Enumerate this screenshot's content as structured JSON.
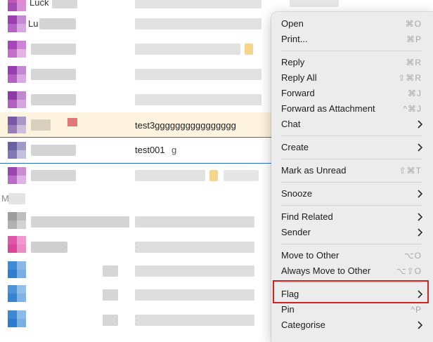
{
  "mail_list": {
    "top_partial_name": "Luck",
    "row2_partial_name": "Lu",
    "highlight_subject": "test3gggggggggggggggg",
    "selected_subject": "test001",
    "selected_preview": "g",
    "section_letter": "M"
  },
  "context_menu": {
    "items": [
      {
        "label": "Open",
        "shortcut": "⌘O",
        "submenu": false
      },
      {
        "label": "Print...",
        "shortcut": "⌘P",
        "submenu": false
      },
      {
        "label": "Reply",
        "shortcut": "⌘R",
        "submenu": false
      },
      {
        "label": "Reply All",
        "shortcut": "⇧⌘R",
        "submenu": false
      },
      {
        "label": "Forward",
        "shortcut": "⌘J",
        "submenu": false
      },
      {
        "label": "Forward as Attachment",
        "shortcut": "^⌘J",
        "submenu": false
      },
      {
        "label": "Chat",
        "shortcut": "",
        "submenu": true
      },
      {
        "label": "Create",
        "shortcut": "",
        "submenu": true
      },
      {
        "label": "Mark as Unread",
        "shortcut": "⇧⌘T",
        "submenu": false
      },
      {
        "label": "Snooze",
        "shortcut": "",
        "submenu": true
      },
      {
        "label": "Find Related",
        "shortcut": "",
        "submenu": true
      },
      {
        "label": "Sender",
        "shortcut": "",
        "submenu": true
      },
      {
        "label": "Move to Other",
        "shortcut": "⌥O",
        "submenu": false
      },
      {
        "label": "Always Move to Other",
        "shortcut": "⌥⇧O",
        "submenu": false
      },
      {
        "label": "Flag",
        "shortcut": "",
        "submenu": true
      },
      {
        "label": "Pin",
        "shortcut": "^P",
        "submenu": false
      },
      {
        "label": "Categorise",
        "shortcut": "",
        "submenu": true
      }
    ]
  },
  "colors": {
    "highlight_row": "#fdf3de",
    "selection_border": "#2b6fb6",
    "flag_outline": "#d61f1f"
  }
}
